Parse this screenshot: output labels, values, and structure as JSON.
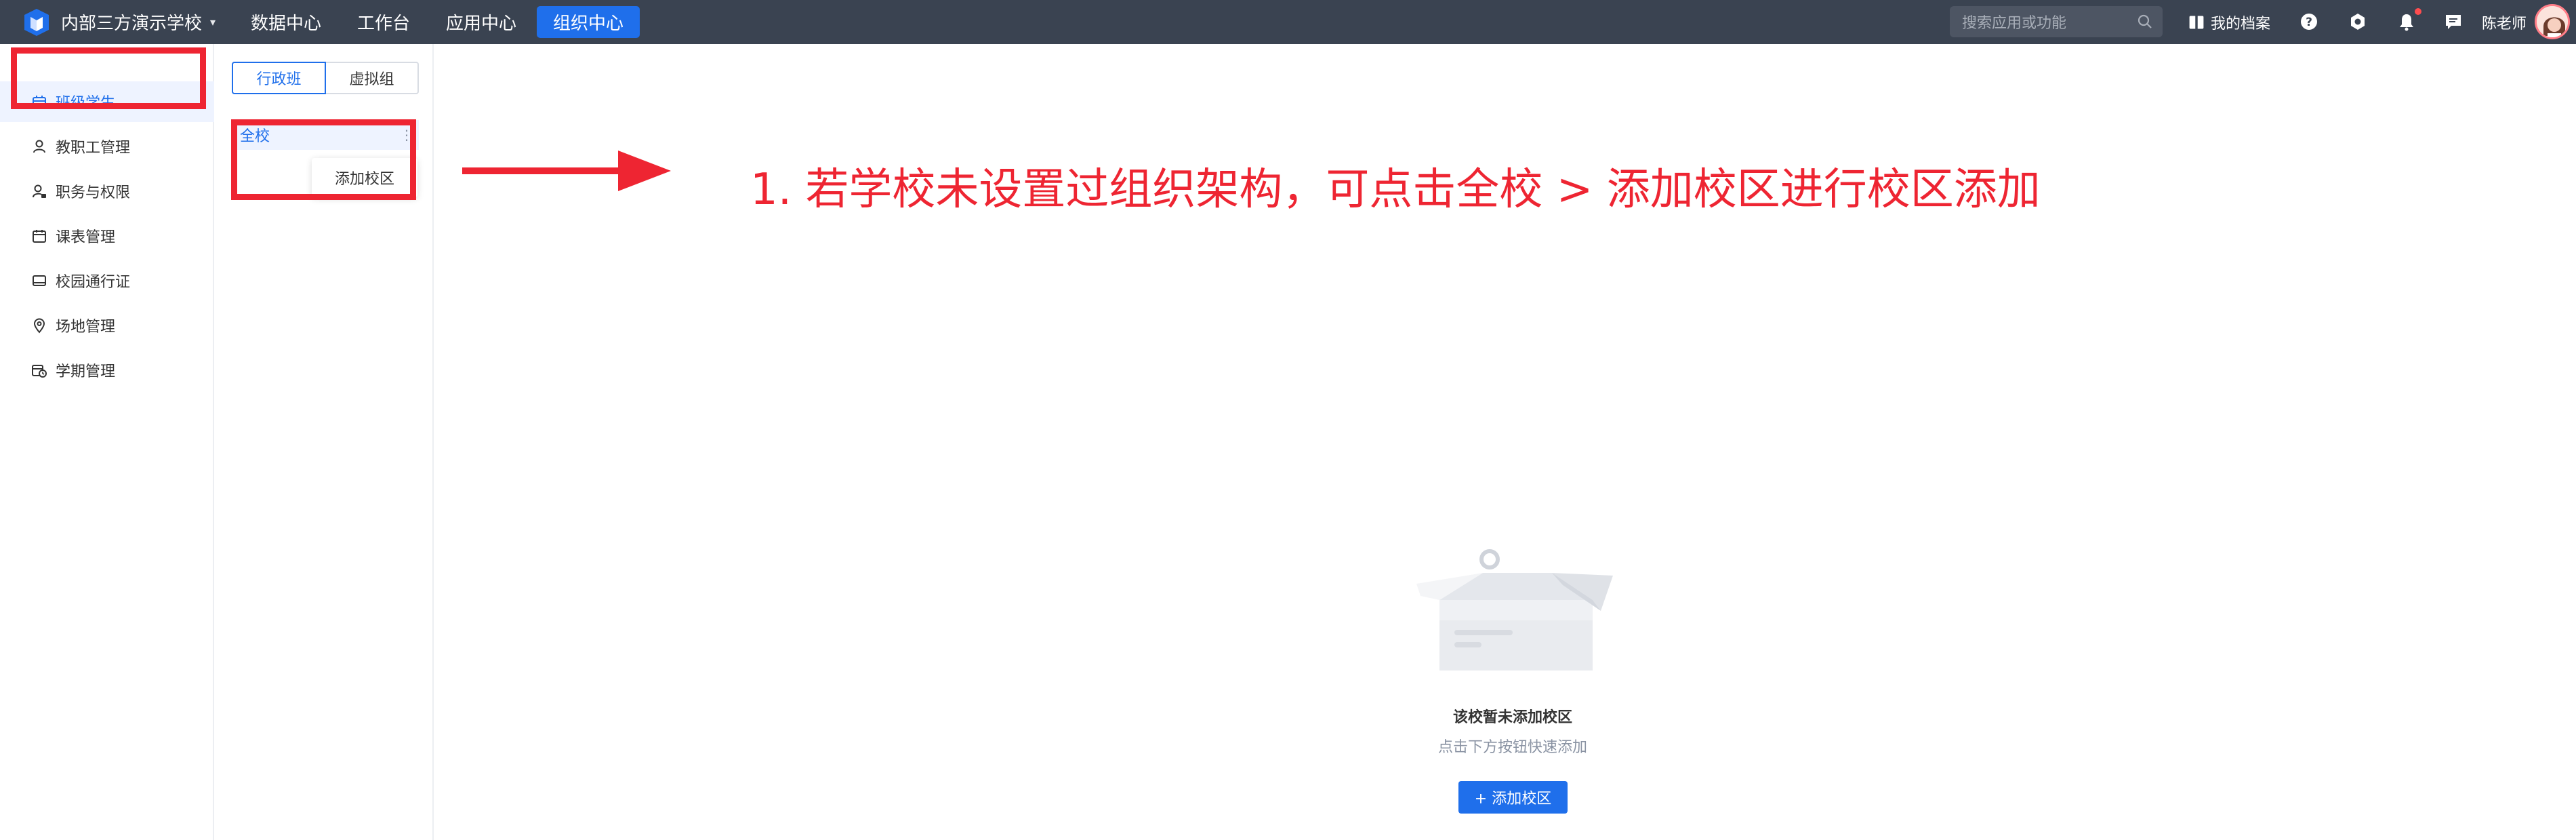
{
  "topbar": {
    "school_name": "内部三方演示学校",
    "nav": [
      {
        "label": "数据中心"
      },
      {
        "label": "工作台"
      },
      {
        "label": "应用中心"
      },
      {
        "label": "组织中心"
      }
    ],
    "active_nav": "组织中心",
    "search_placeholder": "搜索应用或功能",
    "profile_label": "我的档案",
    "user_name": "陈老师",
    "accent_color": "#1f6feb",
    "bar_color": "#3a4351"
  },
  "sidebar": {
    "items": [
      {
        "label": "班级学生",
        "icon": "class-icon"
      },
      {
        "label": "教职工管理",
        "icon": "person-icon"
      },
      {
        "label": "职务与权限",
        "icon": "person-lock-icon"
      },
      {
        "label": "课表管理",
        "icon": "calendar-icon"
      },
      {
        "label": "校园通行证",
        "icon": "card-icon"
      },
      {
        "label": "场地管理",
        "icon": "location-icon"
      },
      {
        "label": "学期管理",
        "icon": "calendar-clock-icon"
      }
    ],
    "active_item": "班级学生"
  },
  "tree": {
    "segments": [
      "行政班",
      "虚拟组"
    ],
    "active_segment": "行政班",
    "root": "全校",
    "more_symbol": "⋮",
    "menu_item": "添加校区"
  },
  "annotation": {
    "text": "1. 若学校未设置过组织架构，可点击全校 > 添加校区进行校区添加",
    "color": "#ee2532"
  },
  "empty_state": {
    "title": "该校暂未添加校区",
    "subtitle": "点击下方按钮快速添加",
    "button_label": "+ 添加校区"
  }
}
